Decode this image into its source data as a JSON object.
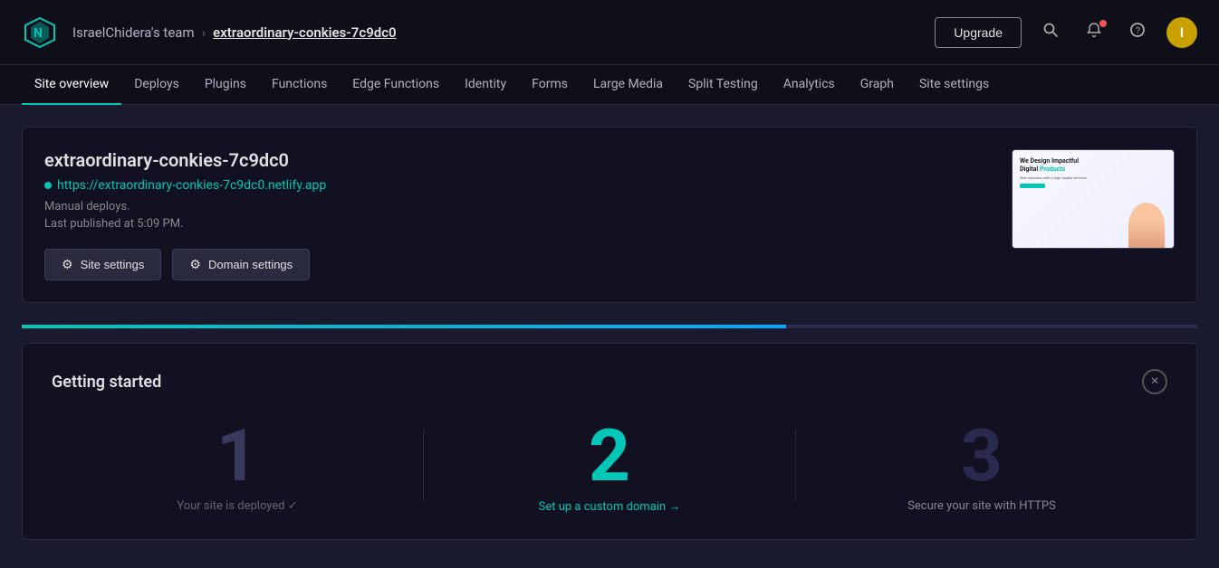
{
  "topbar": {
    "team_name": "IsraelChidera's team",
    "breadcrumb_sep": "›",
    "site_name": "extraordinary-conkies-7c9dc0",
    "upgrade_label": "Upgrade"
  },
  "nav": {
    "items": [
      {
        "id": "site-overview",
        "label": "Site overview",
        "active": true
      },
      {
        "id": "deploys",
        "label": "Deploys",
        "active": false
      },
      {
        "id": "plugins",
        "label": "Plugins",
        "active": false
      },
      {
        "id": "functions",
        "label": "Functions",
        "active": false
      },
      {
        "id": "edge-functions",
        "label": "Edge Functions",
        "active": false
      },
      {
        "id": "identity",
        "label": "Identity",
        "active": false
      },
      {
        "id": "forms",
        "label": "Forms",
        "active": false
      },
      {
        "id": "large-media",
        "label": "Large Media",
        "active": false
      },
      {
        "id": "split-testing",
        "label": "Split Testing",
        "active": false
      },
      {
        "id": "analytics",
        "label": "Analytics",
        "active": false
      },
      {
        "id": "graph",
        "label": "Graph",
        "active": false
      },
      {
        "id": "site-settings",
        "label": "Site settings",
        "active": false
      }
    ]
  },
  "site_card": {
    "site_name": "extraordinary-conkies-7c9dc0",
    "site_url": "https://extraordinary-conkies-7c9dc0.netlify.app",
    "deploy_type": "Manual deploys.",
    "last_published": "Last published at 5:09 PM.",
    "site_settings_label": "Site settings",
    "domain_settings_label": "Domain settings"
  },
  "preview": {
    "headline1": "We Design Impactful",
    "headline2": "Digital",
    "headline3": "Products"
  },
  "getting_started": {
    "title": "Getting started",
    "close_label": "×",
    "steps": [
      {
        "number": "1",
        "label": "Your site is deployed ✓",
        "state": "done"
      },
      {
        "number": "2",
        "label": "Set up a custom domain →",
        "state": "active"
      },
      {
        "number": "3",
        "label": "Secure your site with HTTPS",
        "state": "pending"
      }
    ]
  },
  "icons": {
    "search": "🔍",
    "bell": "🔔",
    "netlify": "◈",
    "gear": "⚙",
    "user_initial": "I"
  },
  "colors": {
    "accent": "#00c7b7",
    "brand_bg": "#0f0f1a",
    "card_bg": "#111122",
    "avatar_bg": "#c8a000"
  }
}
